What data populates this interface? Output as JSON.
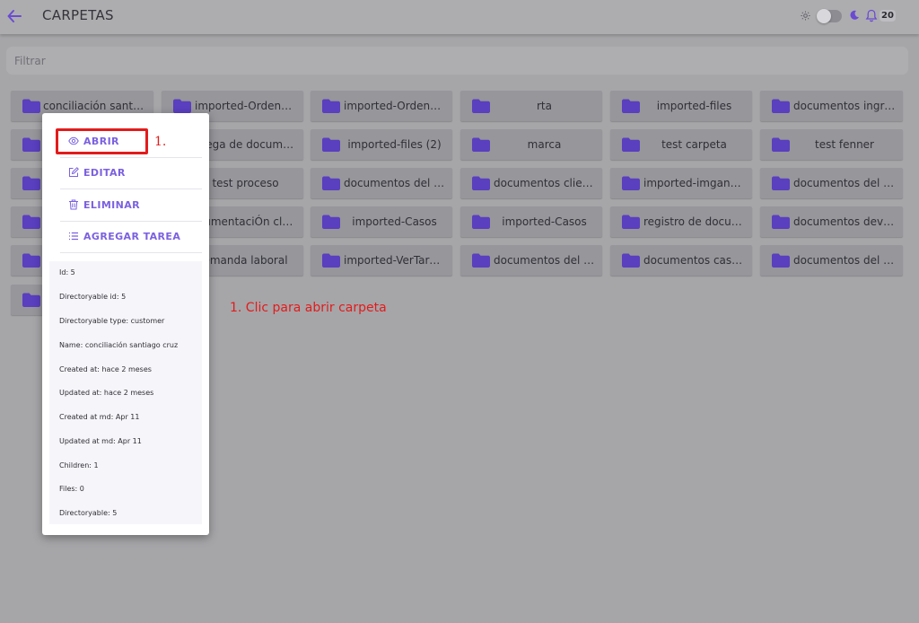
{
  "header": {
    "title": "CARPETAS",
    "notification_count": "20"
  },
  "filter": {
    "placeholder": "Filtrar"
  },
  "folders": {
    "r0": [
      "conciliación santi…",
      "imported-Ordena…",
      "imported-Ordena…",
      "rta",
      "imported-files",
      "documentos ingre…"
    ],
    "r1": [
      "",
      "trega de docum…",
      "imported-files (2)",
      "marca",
      "test carpeta",
      "test fenner"
    ],
    "r2": [
      "",
      "test proceso",
      "documentos del p…",
      "documentos clien…",
      "imported-imgane…",
      "documentos del cl…"
    ],
    "r3": [
      "",
      "cumentaciÓn cl…",
      "imported-Casos",
      "imported-Casos",
      "registro de docum…",
      "documentos devs…"
    ],
    "r4": [
      "",
      "emanda laboral",
      "imported-VerTare…",
      "documentos del p…",
      "documentos caso 2",
      "documentos del c…"
    ],
    "r5": [
      ""
    ]
  },
  "menu": {
    "open": "ABRIR",
    "edit": "EDITAR",
    "delete": "ELIMINAR",
    "add_task": "AGREGAR TAREA"
  },
  "details": [
    "Id: 5",
    "Directoryable id: 5",
    "Directoryable type: customer",
    "Name: conciliación santiago cruz",
    "Created at: hace 2 meses",
    "Updated at: hace 2 meses",
    "Created at md: Apr 11",
    "Updated at md: Apr 11",
    "Children: 1",
    "Files: 0",
    "Directoryable: 5"
  ],
  "annotations": {
    "step_marker": "1.",
    "step_text": "1. Clic para abrir carpeta"
  },
  "colors": {
    "accent": "#7b61e0",
    "folder_icon": "#5a3fbf",
    "annotation": "#e31b1b"
  }
}
